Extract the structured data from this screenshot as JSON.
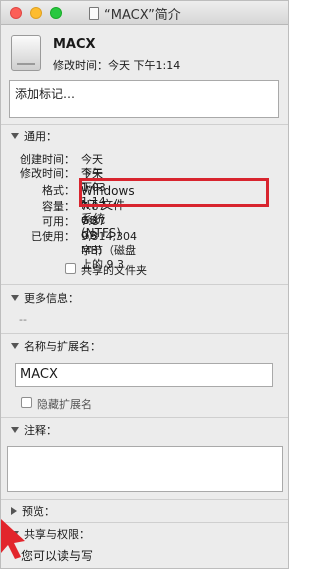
{
  "window": {
    "title": "“MACX”简介"
  },
  "header": {
    "name": "MACX",
    "modified": "修改时间：今天 下午1:14"
  },
  "tags": {
    "placeholder": "添加标记…"
  },
  "general": {
    "label": "通用：",
    "rows": [
      {
        "label": "创建时间：",
        "value": "今天 下午1:03"
      },
      {
        "label": "修改时间：",
        "value": "今天 下午1:14"
      },
      {
        "label": "格式：",
        "value": "Windows NT 文件系统 (NTFS)"
      },
      {
        "label": "容量：",
        "value": "7.87 GB"
      },
      {
        "label": "可用：",
        "value": "7.87 GB"
      },
      {
        "label": "已使用：",
        "value": "9,314,304 字节（磁盘上的 9.3"
      },
      {
        "label": "",
        "value": "MB)"
      }
    ],
    "shared_folder_label": "共享的文件夹"
  },
  "more_info": {
    "label": "更多信息：",
    "value": "--"
  },
  "name_ext": {
    "label": "名称与扩展名：",
    "name_value": "MACX",
    "hide_ext_label": "隐藏扩展名"
  },
  "comments": {
    "label": "注释："
  },
  "preview": {
    "label": "预览："
  },
  "sharing": {
    "label": "共享与权限：",
    "value": "您可以读与写"
  },
  "colors": {
    "highlight": "#d8242e",
    "arrow": "#e2252c"
  }
}
